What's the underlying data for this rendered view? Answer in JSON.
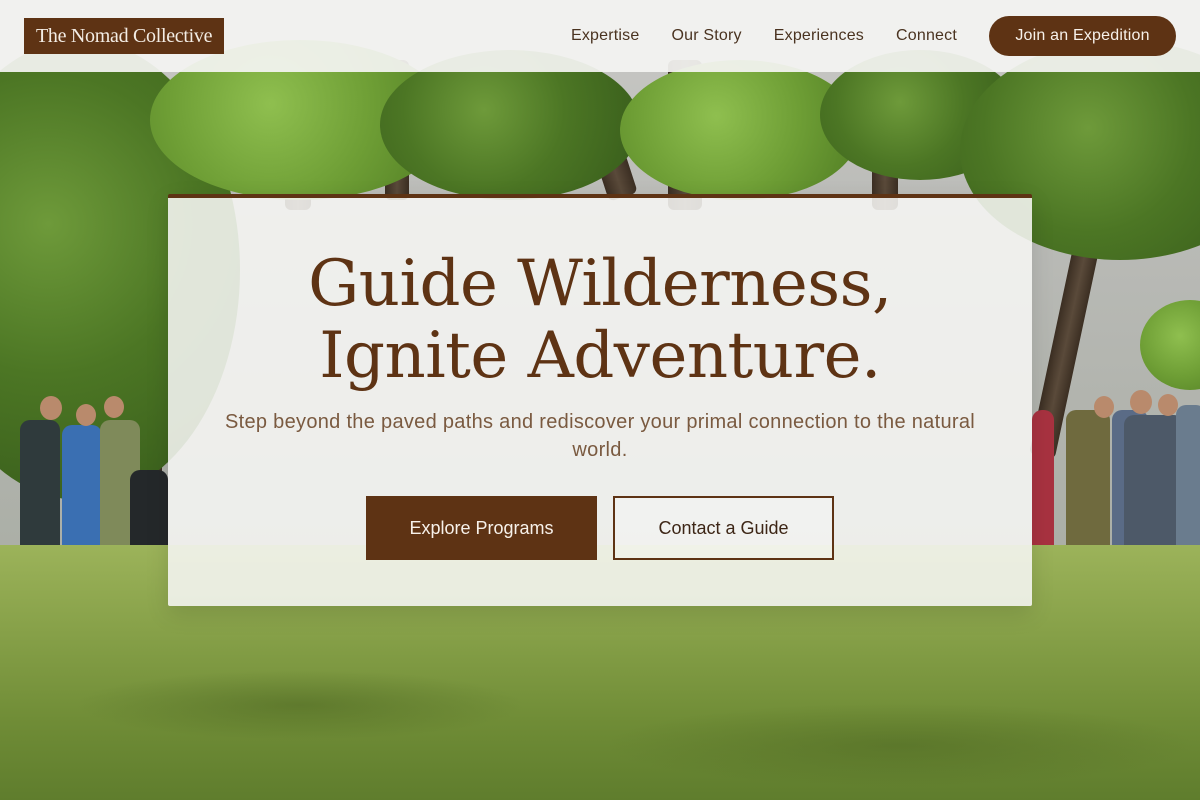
{
  "header": {
    "logo": "The Nomad Collective",
    "nav": [
      "Expertise",
      "Our Story",
      "Experiences",
      "Connect"
    ],
    "cta": "Join an Expedition"
  },
  "hero": {
    "title_line1": "Guide Wilderness,",
    "title_line2": "Ignite Adventure.",
    "subtitle": "Step beyond the paved paths and rediscover your primal connection to the natural world.",
    "primary_button": "Explore Programs",
    "secondary_button": "Contact a Guide"
  },
  "colors": {
    "brand_brown": "#5e3314",
    "header_bg": "#f4f4f2",
    "subtitle_text": "#7a5a40"
  }
}
